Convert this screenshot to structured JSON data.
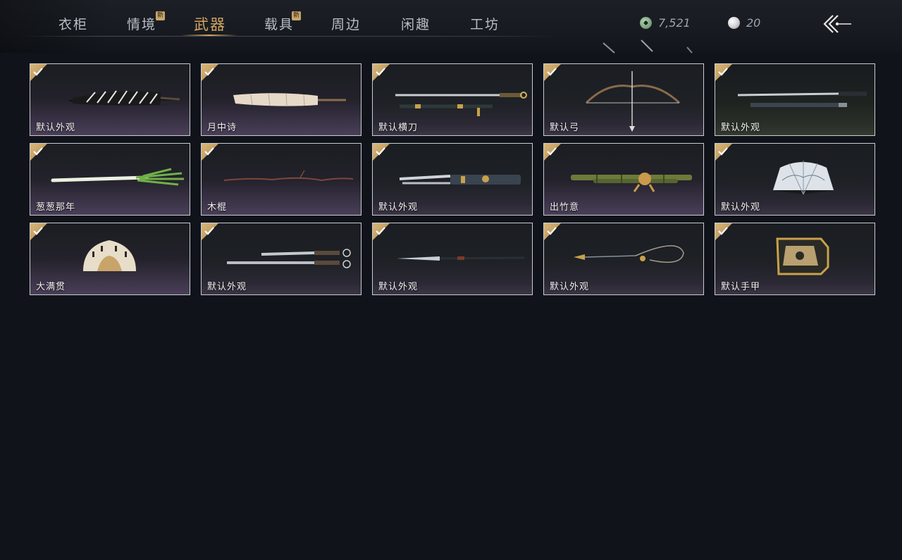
{
  "tabs": [
    {
      "label": "衣柜",
      "new": false,
      "active": false
    },
    {
      "label": "情境",
      "new": true,
      "active": false
    },
    {
      "label": "武器",
      "new": false,
      "active": true
    },
    {
      "label": "载具",
      "new": true,
      "active": false
    },
    {
      "label": "周边",
      "new": false,
      "active": false
    },
    {
      "label": "闲趣",
      "new": false,
      "active": false
    },
    {
      "label": "工坊",
      "new": false,
      "active": false
    }
  ],
  "new_badge_text": "新",
  "currency": {
    "jade": {
      "value": "7,521",
      "icon": "jade-coin-icon",
      "color": "#8fb995"
    },
    "pearl": {
      "value": "20",
      "icon": "pearl-icon",
      "color": "#e8e8ea"
    }
  },
  "back_icon": "back-arrow-icon",
  "items": [
    {
      "label": "默认外观",
      "art": "striped-umbrella",
      "owned": true
    },
    {
      "label": "月中诗",
      "art": "paper-umbrella",
      "owned": true
    },
    {
      "label": "默认横刀",
      "art": "sword-and-scabbard",
      "owned": true
    },
    {
      "label": "默认弓",
      "art": "bow-and-arrow",
      "owned": true
    },
    {
      "label": "默认外观",
      "art": "twin-long-blades",
      "owned": true
    },
    {
      "label": "葱葱那年",
      "art": "green-onion",
      "owned": true
    },
    {
      "label": "木棍",
      "art": "wooden-stick",
      "owned": true
    },
    {
      "label": "默认外观",
      "art": "ornate-short-blades",
      "owned": true
    },
    {
      "label": "出竹意",
      "art": "bamboo-staff",
      "owned": true
    },
    {
      "label": "默认外观",
      "art": "landscape-fan",
      "owned": true
    },
    {
      "label": "大满贯",
      "art": "calligraphy-fan",
      "owned": true
    },
    {
      "label": "默认外观",
      "art": "twin-ring-sabres",
      "owned": true
    },
    {
      "label": "默认外观",
      "art": "long-spear",
      "owned": true
    },
    {
      "label": "默认外观",
      "art": "rope-dart",
      "owned": true
    },
    {
      "label": "默认手甲",
      "art": "gauntlet",
      "owned": true
    }
  ],
  "colors": {
    "accent_gold": "#d4a660",
    "card_border": "#c9cdd2",
    "background": "#10141a"
  }
}
